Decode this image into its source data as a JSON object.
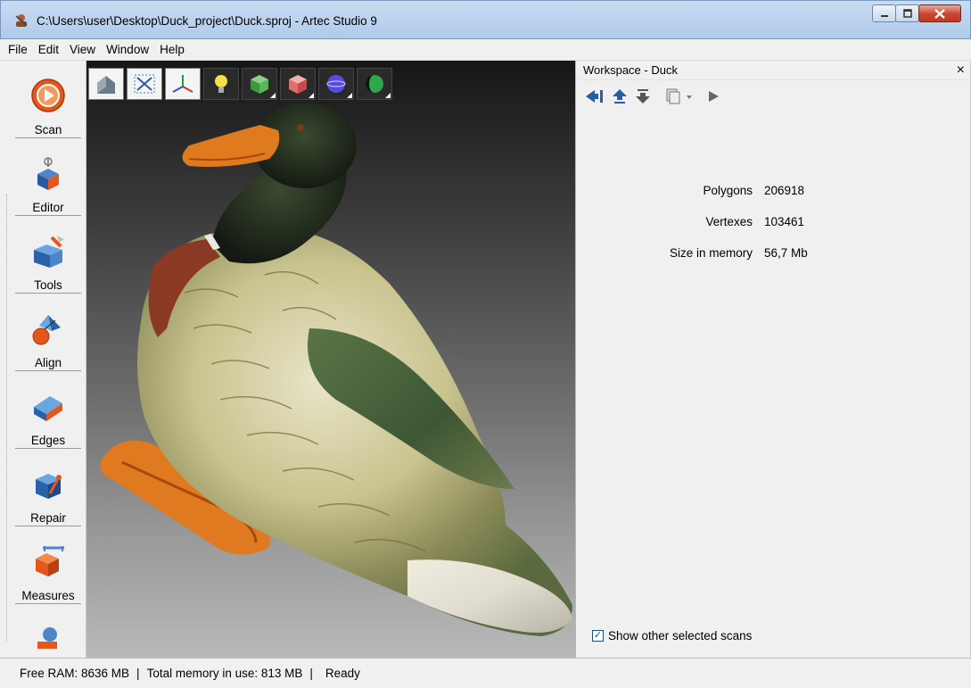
{
  "window": {
    "title": "C:\\Users\\user\\Desktop\\Duck_project\\Duck.sproj - Artec Studio 9",
    "icons": [
      "app-icon",
      "minimize-icon",
      "maximize-icon",
      "close-icon"
    ]
  },
  "menu": {
    "items": [
      "File",
      "Edit",
      "View",
      "Window",
      "Help"
    ]
  },
  "left_toolbar": {
    "items": [
      {
        "label": "Scan",
        "icon": "scan-icon"
      },
      {
        "label": "Editor",
        "icon": "editor-icon"
      },
      {
        "label": "Tools",
        "icon": "tools-icon"
      },
      {
        "label": "Align",
        "icon": "align-icon"
      },
      {
        "label": "Edges",
        "icon": "edges-icon"
      },
      {
        "label": "Repair",
        "icon": "repair-icon"
      },
      {
        "label": "Measures",
        "icon": "measures-icon"
      }
    ]
  },
  "viewport_toolbar": {
    "icons": [
      "home-view-icon",
      "fit-view-icon",
      "axes-icon",
      "lightbulb-icon",
      "texture-mode-icon",
      "solid-mode-icon",
      "sphere-mode-icon",
      "dark-mode-icon"
    ]
  },
  "workspace": {
    "title": "Workspace - Duck",
    "close_label": "×",
    "toolbar_icons": [
      "collapse-left-icon",
      "move-up-icon",
      "move-down-icon",
      "copy-icon",
      "play-icon"
    ],
    "stats": [
      {
        "label": "Polygons",
        "value": "206918"
      },
      {
        "label": "Vertexes",
        "value": "103461"
      },
      {
        "label": "Size in memory",
        "value": "56,7 Mb"
      }
    ],
    "show_other_selected": {
      "label": "Show other selected scans",
      "checked": true
    }
  },
  "status": {
    "free_ram": "Free RAM: 8636 MB",
    "total_memory": "Total memory in use: 813 MB",
    "state": "Ready",
    "separator": "|"
  },
  "colors": {
    "title_gradient": "#bcd3ee",
    "accent_blue": "#2b5aa8",
    "scan_orange": "#e4571c",
    "close_red": "#c8452f"
  }
}
